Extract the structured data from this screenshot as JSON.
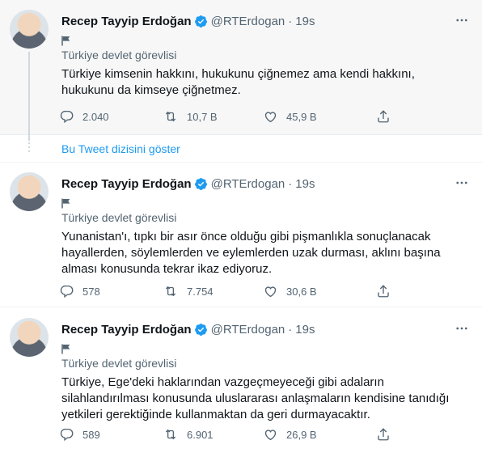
{
  "tweets": [
    {
      "author": "Recep Tayyip Erdoğan",
      "handle": "@RTErdogan",
      "sep": "·",
      "time": "19s",
      "label": "Türkiye devlet görevlisi",
      "text": "Türkiye kimsenin hakkını, hukukunu çiğnemez ama kendi hakkını, hukukunu da kimseye çiğnetmez.",
      "replies": "2.040",
      "retweets": "10,7 B",
      "likes": "45,9 B"
    },
    {
      "author": "Recep Tayyip Erdoğan",
      "handle": "@RTErdogan",
      "sep": "·",
      "time": "19s",
      "label": "Türkiye devlet görevlisi",
      "text": "Yunanistan'ı, tıpkı bir asır önce olduğu gibi pişmanlıkla sonuçlanacak hayallerden, söylemlerden ve eylemlerden uzak durması, aklını başına alması konusunda tekrar ikaz ediyoruz.",
      "replies": "578",
      "retweets": "7.754",
      "likes": "30,6 B"
    },
    {
      "author": "Recep Tayyip Erdoğan",
      "handle": "@RTErdogan",
      "sep": "·",
      "time": "19s",
      "label": "Türkiye devlet görevlisi",
      "text": "Türkiye, Ege'deki haklarından vazgeçmeyeceği gibi adaların silahlandırılması konusunda uluslararası anlaşmaların kendisine tanıdığı yetkileri gerektiğinde kullanmaktan da geri durmayacaktır.",
      "replies": "589",
      "retweets": "6.901",
      "likes": "26,9 B"
    }
  ],
  "show_thread": "Bu Tweet dizisini göster",
  "icons": {
    "verified": "verified-badge-icon",
    "flag": "flag-icon",
    "more": "more-dots-icon",
    "reply": "reply-icon",
    "retweet": "retweet-icon",
    "like": "heart-icon",
    "share": "share-icon"
  },
  "colors": {
    "accent": "#1d9bf0",
    "muted": "#536471",
    "text": "#0f1419"
  }
}
